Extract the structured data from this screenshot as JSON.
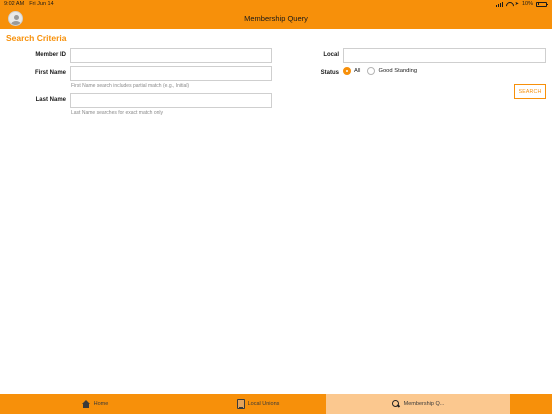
{
  "status_bar": {
    "time": "9:02 AM",
    "date": "Fri Jun 14",
    "battery": "10%"
  },
  "header": {
    "title": "Membership Query",
    "avatar_icon": "person-icon",
    "color": "#f7900a"
  },
  "search": {
    "section_title": "Search Criteria",
    "member_id": {
      "label": "Member ID",
      "value": "",
      "placeholder": ""
    },
    "first_name": {
      "label": "First Name",
      "value": "",
      "placeholder": "",
      "hint": "First Name search includes partial match (e.g., Initial)"
    },
    "last_name": {
      "label": "Last Name",
      "value": "",
      "placeholder": "",
      "hint": "Last Name searches for exact match only"
    },
    "local": {
      "label": "Local",
      "value": "",
      "placeholder": ""
    },
    "status": {
      "label": "Status",
      "options": [
        {
          "label": "All",
          "selected": true
        },
        {
          "label": "Good Standing",
          "selected": false
        }
      ]
    },
    "button_label": "SEARCH"
  },
  "tabbar": {
    "tabs": [
      {
        "label": "Home",
        "icon": "home-icon",
        "active": false
      },
      {
        "label": "Local Unions",
        "icon": "document-icon",
        "active": false
      },
      {
        "label": "Membership Q...",
        "icon": "search-icon",
        "active": true
      }
    ],
    "accent_color": "#f7900a",
    "active_color": "#fbc88f"
  }
}
